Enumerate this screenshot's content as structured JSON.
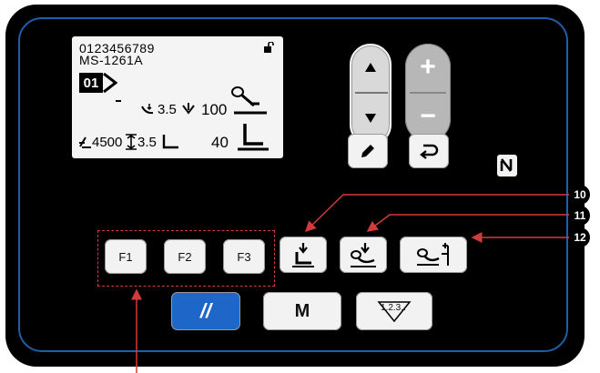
{
  "lcd": {
    "line1": "0123456789",
    "line2": "MS-1261A",
    "pattern_no": "01",
    "row1_val1": "3.5",
    "row1_val2": "100",
    "row2_speed": "4500",
    "row2_val1": "3.5",
    "row2_val2": "40"
  },
  "buttons": {
    "plus": "+",
    "minus": "−",
    "f1": "F1",
    "f2": "F2",
    "f3": "F3",
    "reset": "//",
    "m": "M",
    "counter": "1.2.3.."
  },
  "callouts": {
    "c10": "10",
    "c11": "11",
    "c12": "12"
  },
  "colors": {
    "panel": "#000000",
    "border": "#1f5ea8",
    "blue_button": "#1e66c8",
    "callout_line": "#d23b3b"
  },
  "icons": [
    "lock-icon",
    "pencil-icon",
    "return-icon",
    "nfc-icon",
    "presser-foot-icon",
    "thread-trimmer-icon",
    "thread-clamp-icon"
  ]
}
